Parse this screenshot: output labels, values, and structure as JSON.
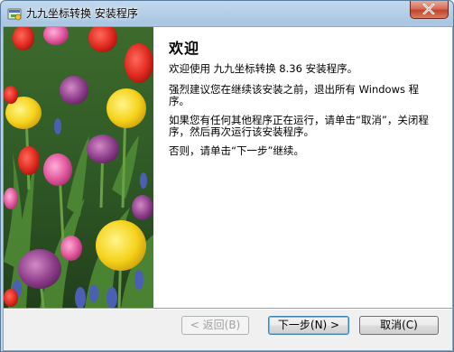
{
  "window": {
    "title": "九九坐标转换 安装程序"
  },
  "welcome": {
    "heading": "欢迎",
    "paragraphs": [
      "欢迎使用 九九坐标转换 8.36 安装程序。",
      "强烈建议您在继续该安装之前，退出所有 Windows 程序。",
      "如果您有任何其他程序正在运行，请单击“取消”，关闭程序，然后再次运行该安装程序。",
      "否则，请单击“下一步”继续。"
    ]
  },
  "buttons": {
    "back": "< 返回(B)",
    "next": "下一步(N) >",
    "cancel": "取消(C)"
  },
  "icons": {
    "close": "close-icon",
    "app": "installer-icon"
  },
  "colors": {
    "title_bar": "#b8d0e8",
    "close_button": "#c3432b",
    "default_button_border": "#3c7fb1"
  }
}
